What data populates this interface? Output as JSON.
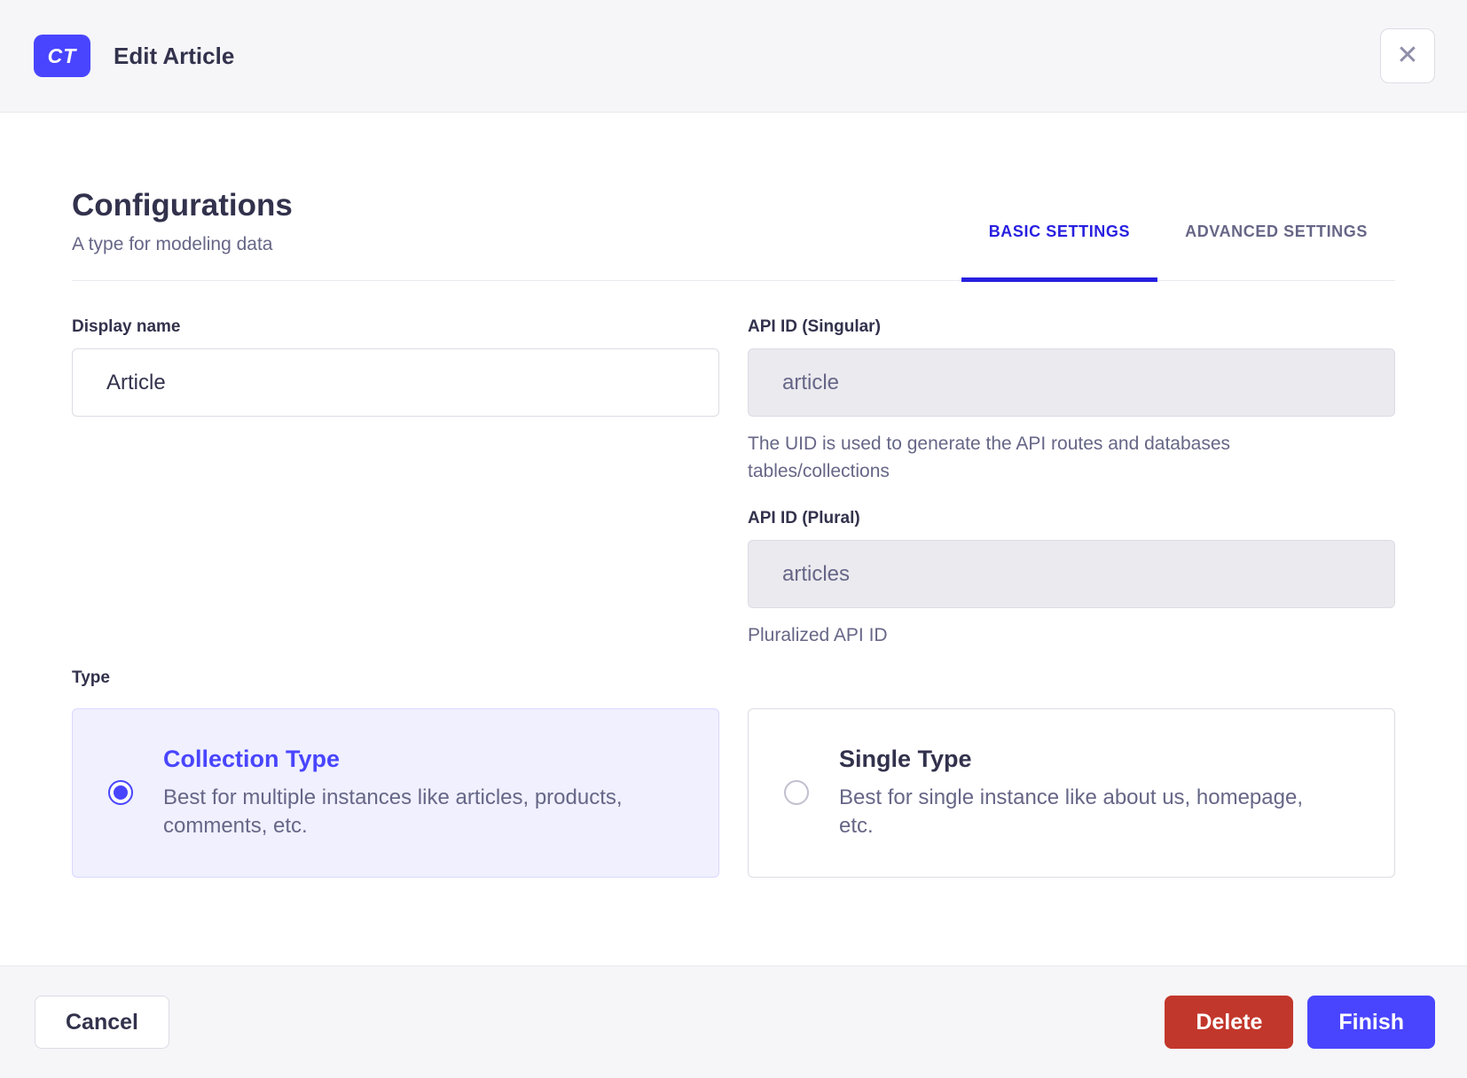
{
  "header": {
    "badge": "CT",
    "title": "Edit Article",
    "close_glyph": "✕"
  },
  "section": {
    "title": "Configurations",
    "subtitle": "A type for modeling data"
  },
  "tabs": {
    "basic": "BASIC SETTINGS",
    "advanced": "ADVANCED SETTINGS",
    "active": "BASIC SETTINGS"
  },
  "fields": {
    "display_name": {
      "label": "Display name",
      "value": "Article"
    },
    "api_id_singular": {
      "label": "API ID (Singular)",
      "value": "article",
      "hint": "The UID is used to generate the API routes and databases tables/collections"
    },
    "api_id_plural": {
      "label": "API ID (Plural)",
      "value": "articles",
      "hint": "Pluralized API ID"
    }
  },
  "type_field": {
    "label": "Type",
    "options": [
      {
        "title": "Collection Type",
        "description": "Best for multiple instances like articles, products, comments, etc.",
        "selected": true
      },
      {
        "title": "Single Type",
        "description": "Best for single instance like about us, homepage, etc.",
        "selected": false
      }
    ]
  },
  "footer": {
    "cancel": "Cancel",
    "delete": "Delete",
    "finish": "Finish"
  },
  "colors": {
    "primary": "#4945ff",
    "primary_tab": "#271fe0",
    "danger": "#c2372b",
    "heading": "#32324d",
    "muted": "#666687",
    "border": "#dcdce4",
    "divider": "#eaeaef",
    "chrome_bg": "#f6f6f9",
    "disabled_bg": "#eaeaef",
    "selected_card_bg": "#f0f0ff",
    "selected_card_border": "#d9d8ff",
    "icon": "#8e8ea9",
    "radio_off": "#c0c0cf"
  }
}
